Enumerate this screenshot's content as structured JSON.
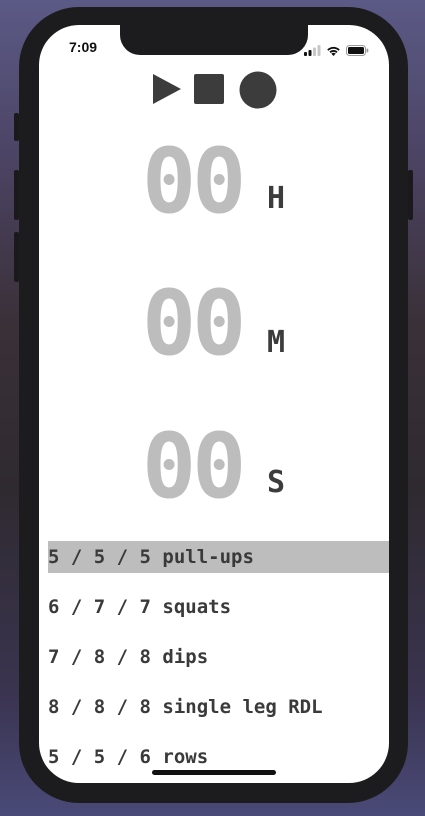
{
  "status_bar": {
    "time": "7:09"
  },
  "controls": {
    "play_icon": "play-icon",
    "stop_icon": "stop-icon",
    "record_icon": "record-icon"
  },
  "timer": {
    "hours": "00",
    "hours_unit": "H",
    "minutes": "00",
    "minutes_unit": "M",
    "seconds": "00",
    "seconds_unit": "S"
  },
  "exercises": [
    {
      "label": "5 / 5 / 5 pull-ups",
      "selected": true
    },
    {
      "label": "6 / 7 / 7 squats",
      "selected": false
    },
    {
      "label": "7 / 8 / 8 dips",
      "selected": false
    },
    {
      "label": "8 / 8 / 8 single leg RDL",
      "selected": false
    },
    {
      "label": "5 / 5 / 6 rows",
      "selected": false
    }
  ],
  "colors": {
    "digits": "#bdbdbd",
    "units": "#3c3c3c",
    "selection": "#bdbdbd",
    "controls": "#3c3c3c"
  }
}
